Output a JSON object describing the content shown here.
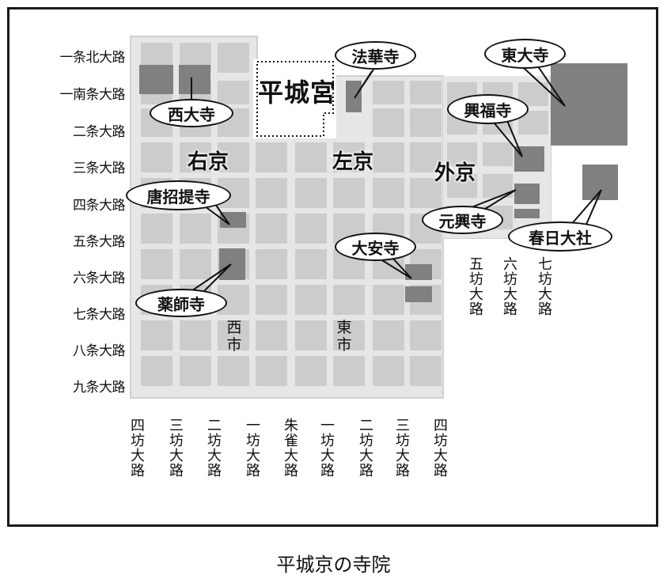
{
  "caption": "平城京の寺院",
  "palace": {
    "label": "平城宮"
  },
  "regions": {
    "ukyo": "右京",
    "sakyo": "左京",
    "gekyo": "外京"
  },
  "markets": {
    "west": "西市",
    "east": "東市"
  },
  "east_west_roads": [
    "一条北大路",
    "一南条大路",
    "二条大路",
    "三条大路",
    "四条大路",
    "五条大路",
    "六条大路",
    "七条大路",
    "八条大路",
    "九条大路"
  ],
  "north_south_roads": [
    "四坊大路",
    "三坊大路",
    "二坊大路",
    "一坊大路",
    "朱雀大路",
    "一坊大路",
    "二坊大路",
    "三坊大路",
    "四坊大路"
  ],
  "outer_roads": [
    "五坊大路",
    "六坊大路",
    "七坊大路"
  ],
  "temples": {
    "saidaiji": "西大寺",
    "hokkeji": "法華寺",
    "todaiji": "東大寺",
    "kofukuji": "興福寺",
    "toshodaiji": "唐招提寺",
    "gangoji": "元興寺",
    "kasuga": "春日大社",
    "daianji": "大安寺",
    "yakushiji": "薬師寺"
  },
  "colors": {
    "block": "#cccccc",
    "temple": "#808080",
    "road": "#ffffff",
    "border": "#1a1a1a"
  }
}
